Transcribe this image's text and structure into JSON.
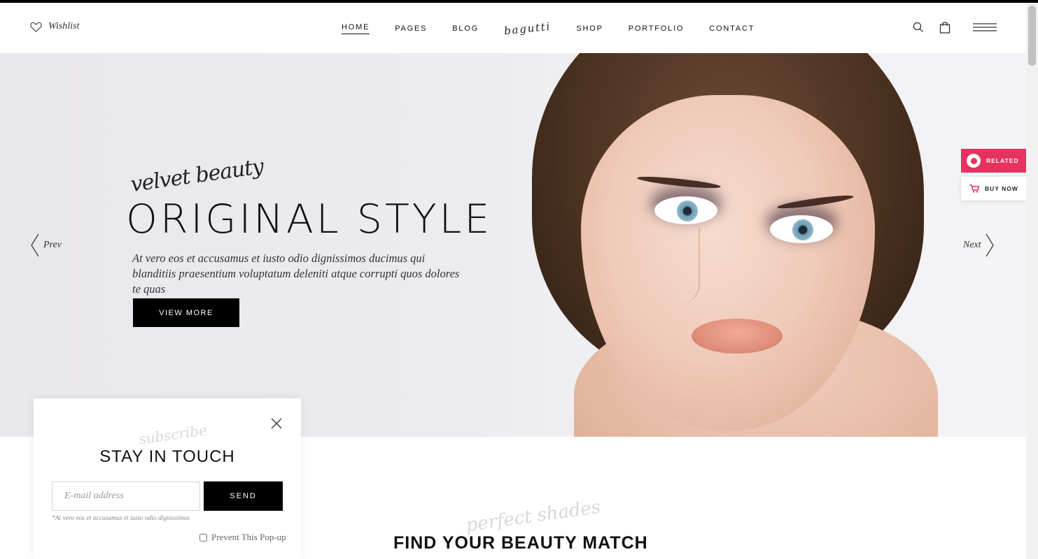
{
  "header": {
    "wishlist_label": "Wishlist",
    "logo_text": "bagutti",
    "nav": [
      {
        "label": "HOME"
      },
      {
        "label": "PAGES"
      },
      {
        "label": "BLOG"
      },
      {
        "label": "SHOP"
      },
      {
        "label": "PORTFOLIO"
      },
      {
        "label": "CONTACT"
      }
    ],
    "icons": [
      "search-icon",
      "shopping-bag-icon",
      "hamburger-menu-icon"
    ]
  },
  "hero": {
    "script": "velvet beauty",
    "title": "ORIGINAL STYLE",
    "text": "At vero eos et accusamus et iusto odio dignissimos ducimus qui blanditiis praesentium voluptatum deleniti atque corrupti quos dolores te quas",
    "button": "VIEW MORE",
    "prev": "Prev",
    "next": "Next"
  },
  "side_tabs": {
    "related": "RELATED",
    "buy_now": "BUY NOW",
    "related_color": "#e5325e"
  },
  "section": {
    "script": "perfect shades",
    "title": "FIND YOUR BEAUTY MATCH"
  },
  "popup": {
    "script": "subscribe",
    "title": "STAY IN TOUCH",
    "email_placeholder": "E-mail address",
    "send_label": "SEND",
    "note": "*At vero eos et accusamus et iusto odio dignissimos",
    "prevent_label": "Prevent This Pop-up"
  }
}
